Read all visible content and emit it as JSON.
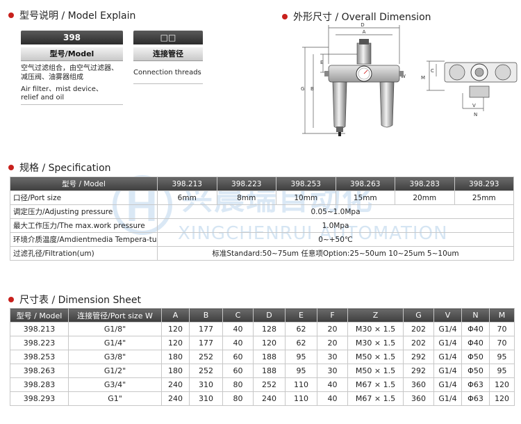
{
  "sections": {
    "model_explain": "型号说明 / Model Explain",
    "overall_dimension": "外形尺寸 / Overall Dimension",
    "specification": "规格 / Specification",
    "dimension_sheet": "尺寸表 / Dimension Sheet"
  },
  "model_explain": {
    "code_box": "398",
    "code_box2": "□□",
    "label1": "型号/Model",
    "label2": "连接管径",
    "desc_cn_1": "空气过滤组合，由空气过滤器、",
    "desc_cn_2": "减压阀、油雾器组成",
    "desc_en_1": "Air filter、mist device、",
    "desc_en_2": "relief and oil",
    "desc2": "Connection threads"
  },
  "drawing_labels": {
    "D": "D",
    "A": "A",
    "E": "E",
    "B": "B",
    "G": "G",
    "W": "W",
    "C": "C",
    "M": "M",
    "V": "V",
    "N": "N"
  },
  "watermark": {
    "cn": "兴晨瑞自动化",
    "en": "XINGCHENRUI AUTOMATION"
  },
  "spec_table": {
    "header_label": "型号 / Model",
    "models": [
      "398.213",
      "398.223",
      "398.253",
      "398.263",
      "398.283",
      "398.293"
    ],
    "rows": {
      "port_label": "口径/Port size",
      "port_values": [
        "6mm",
        "8mm",
        "10mm",
        "15mm",
        "20mm",
        "25mm"
      ],
      "adjust_label": "调定压力/Adjusting pressure",
      "adjust_value": "0.05~1.0Mpa",
      "maxwork_label": "最大工作压力/The max.work pressure",
      "maxwork_value": "1.0Mpa",
      "ambient_label": "环境介质温度/Amdientmedia Tempera-ture",
      "ambient_value": "0~+50℃",
      "filter_label": "过滤孔径/Filtration(um)",
      "filter_value": "标准Standard:50~75um  任意项Option:25~50um 10~25um 5~10um"
    }
  },
  "dim_table": {
    "headers": [
      "型号 / Model",
      "连接管径/Port size W",
      "A",
      "B",
      "C",
      "D",
      "E",
      "F",
      "Z",
      "G",
      "V",
      "N",
      "M"
    ],
    "rows": [
      [
        "398.213",
        "G1/8\"",
        "120",
        "177",
        "40",
        "128",
        "62",
        "20",
        "M30 × 1.5",
        "202",
        "G1/4",
        "Φ40",
        "70"
      ],
      [
        "398.223",
        "G1/4\"",
        "120",
        "177",
        "40",
        "120",
        "62",
        "20",
        "M30 × 1.5",
        "202",
        "G1/4",
        "Φ40",
        "70"
      ],
      [
        "398.253",
        "G3/8\"",
        "180",
        "252",
        "60",
        "188",
        "95",
        "30",
        "M50 × 1.5",
        "292",
        "G1/4",
        "Φ50",
        "95"
      ],
      [
        "398.263",
        "G1/2\"",
        "180",
        "252",
        "60",
        "188",
        "95",
        "30",
        "M50 × 1.5",
        "292",
        "G1/4",
        "Φ50",
        "95"
      ],
      [
        "398.283",
        "G3/4\"",
        "240",
        "310",
        "80",
        "252",
        "110",
        "40",
        "M67 × 1.5",
        "360",
        "G1/4",
        "Φ63",
        "120"
      ],
      [
        "398.293",
        "G1\"",
        "240",
        "310",
        "80",
        "240",
        "110",
        "40",
        "M67 × 1.5",
        "360",
        "G1/4",
        "Φ63",
        "120"
      ]
    ]
  },
  "colors": {
    "accent_dot": "#c8201c",
    "header_dark": "#3e3e3e",
    "watermark": "#96bee1"
  }
}
